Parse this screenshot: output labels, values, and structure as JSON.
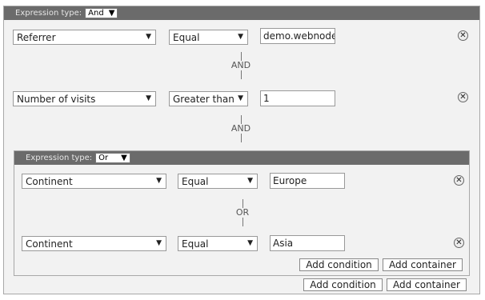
{
  "outer": {
    "expression_type_label": "Expression type:",
    "expression_type_value": "And",
    "rows": [
      {
        "field": "Referrer",
        "op": "Equal",
        "value": "demo.webnodes"
      },
      {
        "field": "Number of visits",
        "op": "Greater than",
        "value": "1"
      }
    ],
    "connector": "AND",
    "add_condition": "Add condition",
    "add_container": "Add container"
  },
  "inner": {
    "expression_type_label": "Expression type:",
    "expression_type_value": "Or",
    "rows": [
      {
        "field": "Continent",
        "op": "Equal",
        "value": "Europe"
      },
      {
        "field": "Continent",
        "op": "Equal",
        "value": "Asia"
      }
    ],
    "connector": "OR",
    "add_condition": "Add condition",
    "add_container": "Add container"
  },
  "icons": {
    "delete": "close-circle-icon",
    "dropdown": "triangle-down-icon"
  }
}
